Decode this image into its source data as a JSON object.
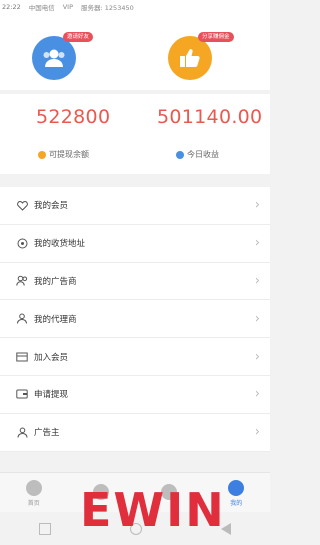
{
  "status": {
    "time": "22:22",
    "carrier": "中国电信",
    "vip": "VIP",
    "extra": "服务器: 1253450"
  },
  "top": {
    "left_badge": "邀请好友",
    "right_badge": "分享赚佣金"
  },
  "stats": {
    "left_value": "522800",
    "right_value": "501140.00",
    "left_label": "可提现余额",
    "right_label": "今日收益",
    "left_dot_color": "#f5a623",
    "right_dot_color": "#4a90e2"
  },
  "menu": {
    "items": [
      {
        "label": "我的会员",
        "icon": "heart-shield-icon"
      },
      {
        "label": "我的收货地址",
        "icon": "location-icon"
      },
      {
        "label": "我的广告商",
        "icon": "users-icon"
      },
      {
        "label": "我的代理商",
        "icon": "agent-icon"
      },
      {
        "label": "加入会员",
        "icon": "card-icon"
      },
      {
        "label": "申请提现",
        "icon": "wallet-icon"
      },
      {
        "label": "广告主",
        "icon": "person-icon"
      }
    ]
  },
  "tabs": [
    {
      "label": "首页",
      "icon": "home-icon"
    },
    {
      "label": "",
      "icon": "shop-icon"
    },
    {
      "label": "",
      "icon": "compass-icon"
    },
    {
      "label": "我的",
      "icon": "user-icon"
    }
  ],
  "watermark": "EWIN",
  "colors": {
    "accent": "#3d7fe0",
    "value_red": "#e85a4f",
    "watermark_red": "#e02e3c"
  }
}
